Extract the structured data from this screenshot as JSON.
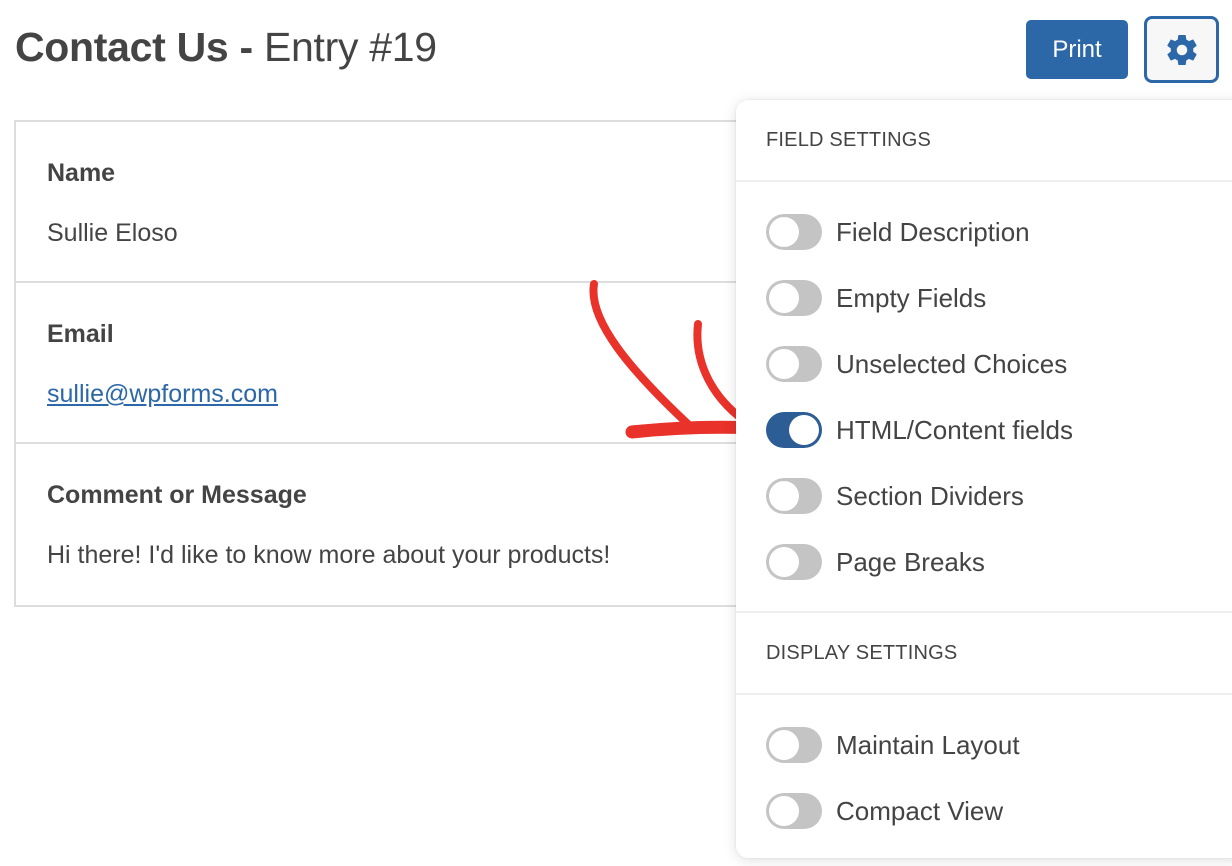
{
  "header": {
    "form_name": "Contact Us",
    "separator": " - ",
    "entry_label": "Entry #19",
    "print_label": "Print",
    "settings_icon": "gear-icon"
  },
  "entry": {
    "fields": [
      {
        "label": "Name",
        "value": "Sullie Eloso",
        "is_link": false
      },
      {
        "label": "Email",
        "value": "sullie@wpforms.com",
        "is_link": true
      },
      {
        "label": "Comment or Message",
        "value": "Hi there! I'd like to know more about your products!",
        "is_link": false
      }
    ]
  },
  "annotation": {
    "arrow_color": "#e8322a",
    "arrow_points_to": "HTML/Content fields"
  },
  "settings_panel": {
    "field_settings": {
      "heading": "FIELD SETTINGS",
      "toggles": [
        {
          "label": "Field Description",
          "on": false
        },
        {
          "label": "Empty Fields",
          "on": false
        },
        {
          "label": "Unselected Choices",
          "on": false
        },
        {
          "label": "HTML/Content fields",
          "on": true
        },
        {
          "label": "Section Dividers",
          "on": false
        },
        {
          "label": "Page Breaks",
          "on": false
        }
      ]
    },
    "display_settings": {
      "heading": "DISPLAY SETTINGS",
      "toggles": [
        {
          "label": "Maintain Layout",
          "on": false
        },
        {
          "label": "Compact View",
          "on": false
        }
      ]
    }
  },
  "colors": {
    "accent": "#2c68a8",
    "toggle_on": "#2c5d94",
    "toggle_off": "#c4c4c4",
    "text": "#444444"
  }
}
